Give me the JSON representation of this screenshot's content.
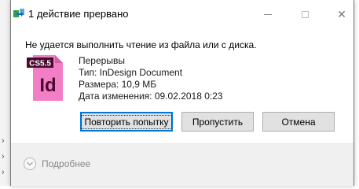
{
  "dialog": {
    "title": "1 действие прервано",
    "message": "Не удается выполнить чтение из файла или с диска.",
    "file": {
      "name": "Перерывы",
      "type": "Тип: InDesign Document",
      "size": "Размера: 10,9 МБ",
      "modified": "Дата изменения: 09.02.2018 0:23",
      "icon_badge": "CS5.5",
      "icon_letters": "Id",
      "icon": "indesign-document-icon"
    },
    "buttons": {
      "retry": "Повторить попытку",
      "skip": "Пропустить",
      "cancel": "Отмена"
    },
    "details": {
      "label": "Подробнее"
    },
    "window_controls": {
      "close": "✕"
    }
  },
  "colors": {
    "accent": "#0078d7",
    "indesign_pink": "#f27ec6",
    "indesign_dark": "#4a0a2e"
  }
}
